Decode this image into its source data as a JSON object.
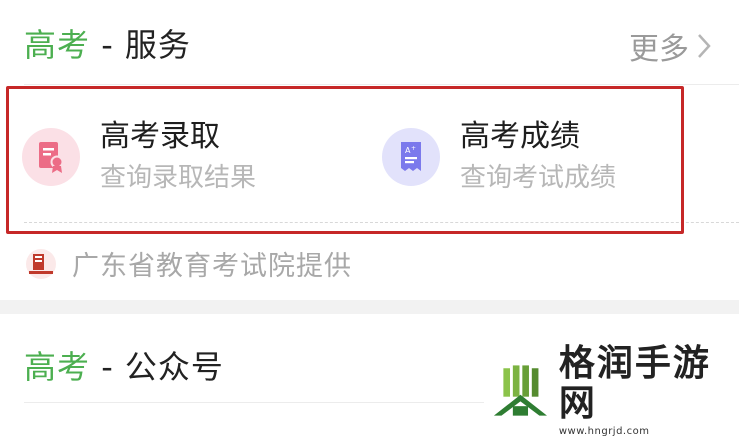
{
  "services_section": {
    "title_accent": "高考",
    "title_rest": " - 服务",
    "more_label": "更多",
    "items": [
      {
        "title": "高考录取",
        "subtitle": "查询录取结果",
        "icon": "admission-certificate-icon",
        "color": "#ec6c86"
      },
      {
        "title": "高考成绩",
        "subtitle": "查询考试成绩",
        "icon": "score-report-icon",
        "color": "#7b79ec"
      }
    ],
    "provider": "广东省教育考试院提供",
    "highlight_color": "#c62828"
  },
  "official_section": {
    "title_accent": "高考",
    "title_rest": " - 公众号"
  },
  "watermark": {
    "title": "格润手游网",
    "url": "www.hngrjd.com"
  },
  "colors": {
    "accent": "#4caf50",
    "muted": "#b7b7b7"
  }
}
